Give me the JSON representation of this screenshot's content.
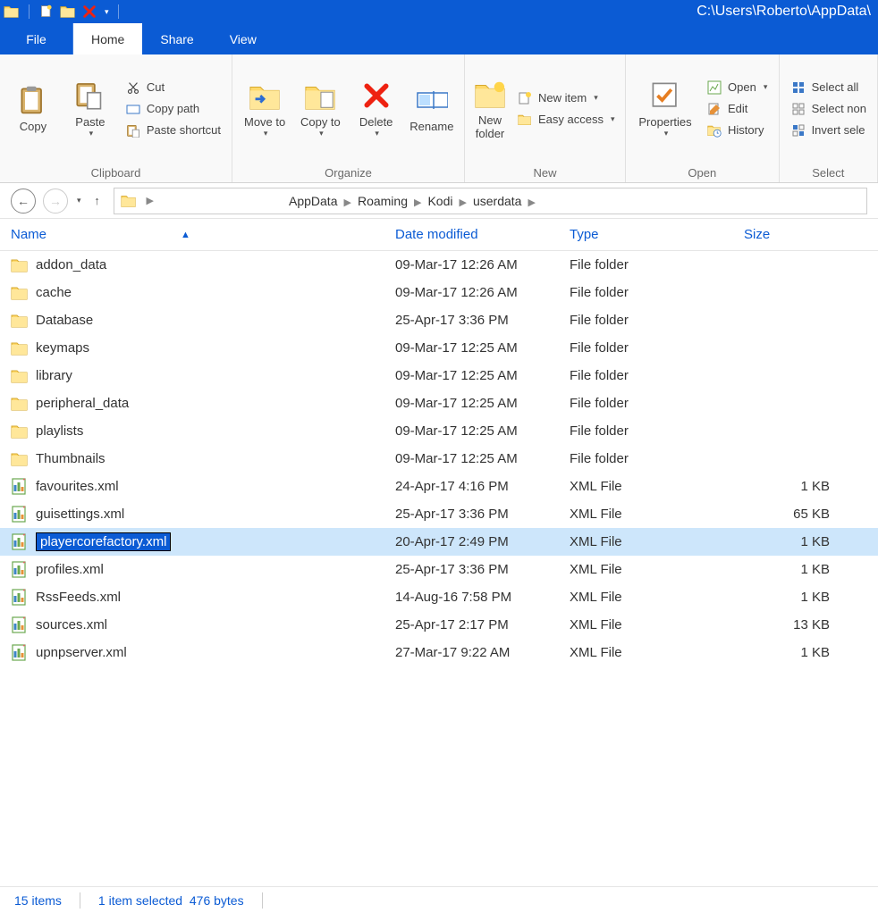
{
  "title_path": "C:\\Users\\Roberto\\AppData\\",
  "tabs": {
    "file": "File",
    "home": "Home",
    "share": "Share",
    "view": "View"
  },
  "ribbon": {
    "clipboard": {
      "label": "Clipboard",
      "copy": "Copy",
      "paste": "Paste",
      "cut": "Cut",
      "copypath": "Copy path",
      "pasteshort": "Paste shortcut"
    },
    "organize": {
      "label": "Organize",
      "moveto": "Move to",
      "copyto": "Copy to",
      "delete": "Delete",
      "rename": "Rename",
      "dd": "▾"
    },
    "new": {
      "label": "New",
      "newfolder": "New folder",
      "newitem": "New item",
      "easyaccess": "Easy access"
    },
    "open": {
      "label": "Open",
      "properties": "Properties",
      "open": "Open",
      "edit": "Edit",
      "history": "History"
    },
    "select": {
      "label": "Select",
      "selectall": "Select all",
      "selectnone": "Select non",
      "invert": "Invert sele"
    }
  },
  "breadcrumb": [
    "AppData",
    "Roaming",
    "Kodi",
    "userdata"
  ],
  "columns": {
    "name": "Name",
    "date": "Date modified",
    "type": "Type",
    "size": "Size"
  },
  "files": [
    {
      "icon": "folder",
      "name": "addon_data",
      "date": "09-Mar-17 12:26 AM",
      "type": "File folder",
      "size": ""
    },
    {
      "icon": "folder",
      "name": "cache",
      "date": "09-Mar-17 12:26 AM",
      "type": "File folder",
      "size": ""
    },
    {
      "icon": "folder",
      "name": "Database",
      "date": "25-Apr-17 3:36 PM",
      "type": "File folder",
      "size": ""
    },
    {
      "icon": "folder",
      "name": "keymaps",
      "date": "09-Mar-17 12:25 AM",
      "type": "File folder",
      "size": ""
    },
    {
      "icon": "folder",
      "name": "library",
      "date": "09-Mar-17 12:25 AM",
      "type": "File folder",
      "size": ""
    },
    {
      "icon": "folder",
      "name": "peripheral_data",
      "date": "09-Mar-17 12:25 AM",
      "type": "File folder",
      "size": ""
    },
    {
      "icon": "folder",
      "name": "playlists",
      "date": "09-Mar-17 12:25 AM",
      "type": "File folder",
      "size": ""
    },
    {
      "icon": "folder",
      "name": "Thumbnails",
      "date": "09-Mar-17 12:25 AM",
      "type": "File folder",
      "size": ""
    },
    {
      "icon": "xml",
      "name": "favourites.xml",
      "date": "24-Apr-17 4:16 PM",
      "type": "XML File",
      "size": "1 KB"
    },
    {
      "icon": "xml",
      "name": "guisettings.xml",
      "date": "25-Apr-17 3:36 PM",
      "type": "XML File",
      "size": "65 KB"
    },
    {
      "icon": "xml",
      "name": "playercorefactory.xml",
      "date": "20-Apr-17 2:49 PM",
      "type": "XML File",
      "size": "1 KB",
      "selected": true,
      "rename": true
    },
    {
      "icon": "xml",
      "name": "profiles.xml",
      "date": "25-Apr-17 3:36 PM",
      "type": "XML File",
      "size": "1 KB"
    },
    {
      "icon": "xml",
      "name": "RssFeeds.xml",
      "date": "14-Aug-16 7:58 PM",
      "type": "XML File",
      "size": "1 KB"
    },
    {
      "icon": "xml",
      "name": "sources.xml",
      "date": "25-Apr-17 2:17 PM",
      "type": "XML File",
      "size": "13 KB"
    },
    {
      "icon": "xml",
      "name": "upnpserver.xml",
      "date": "27-Mar-17 9:22 AM",
      "type": "XML File",
      "size": "1 KB"
    }
  ],
  "status": {
    "items": "15 items",
    "selected": "1 item selected",
    "bytes": "476 bytes"
  }
}
